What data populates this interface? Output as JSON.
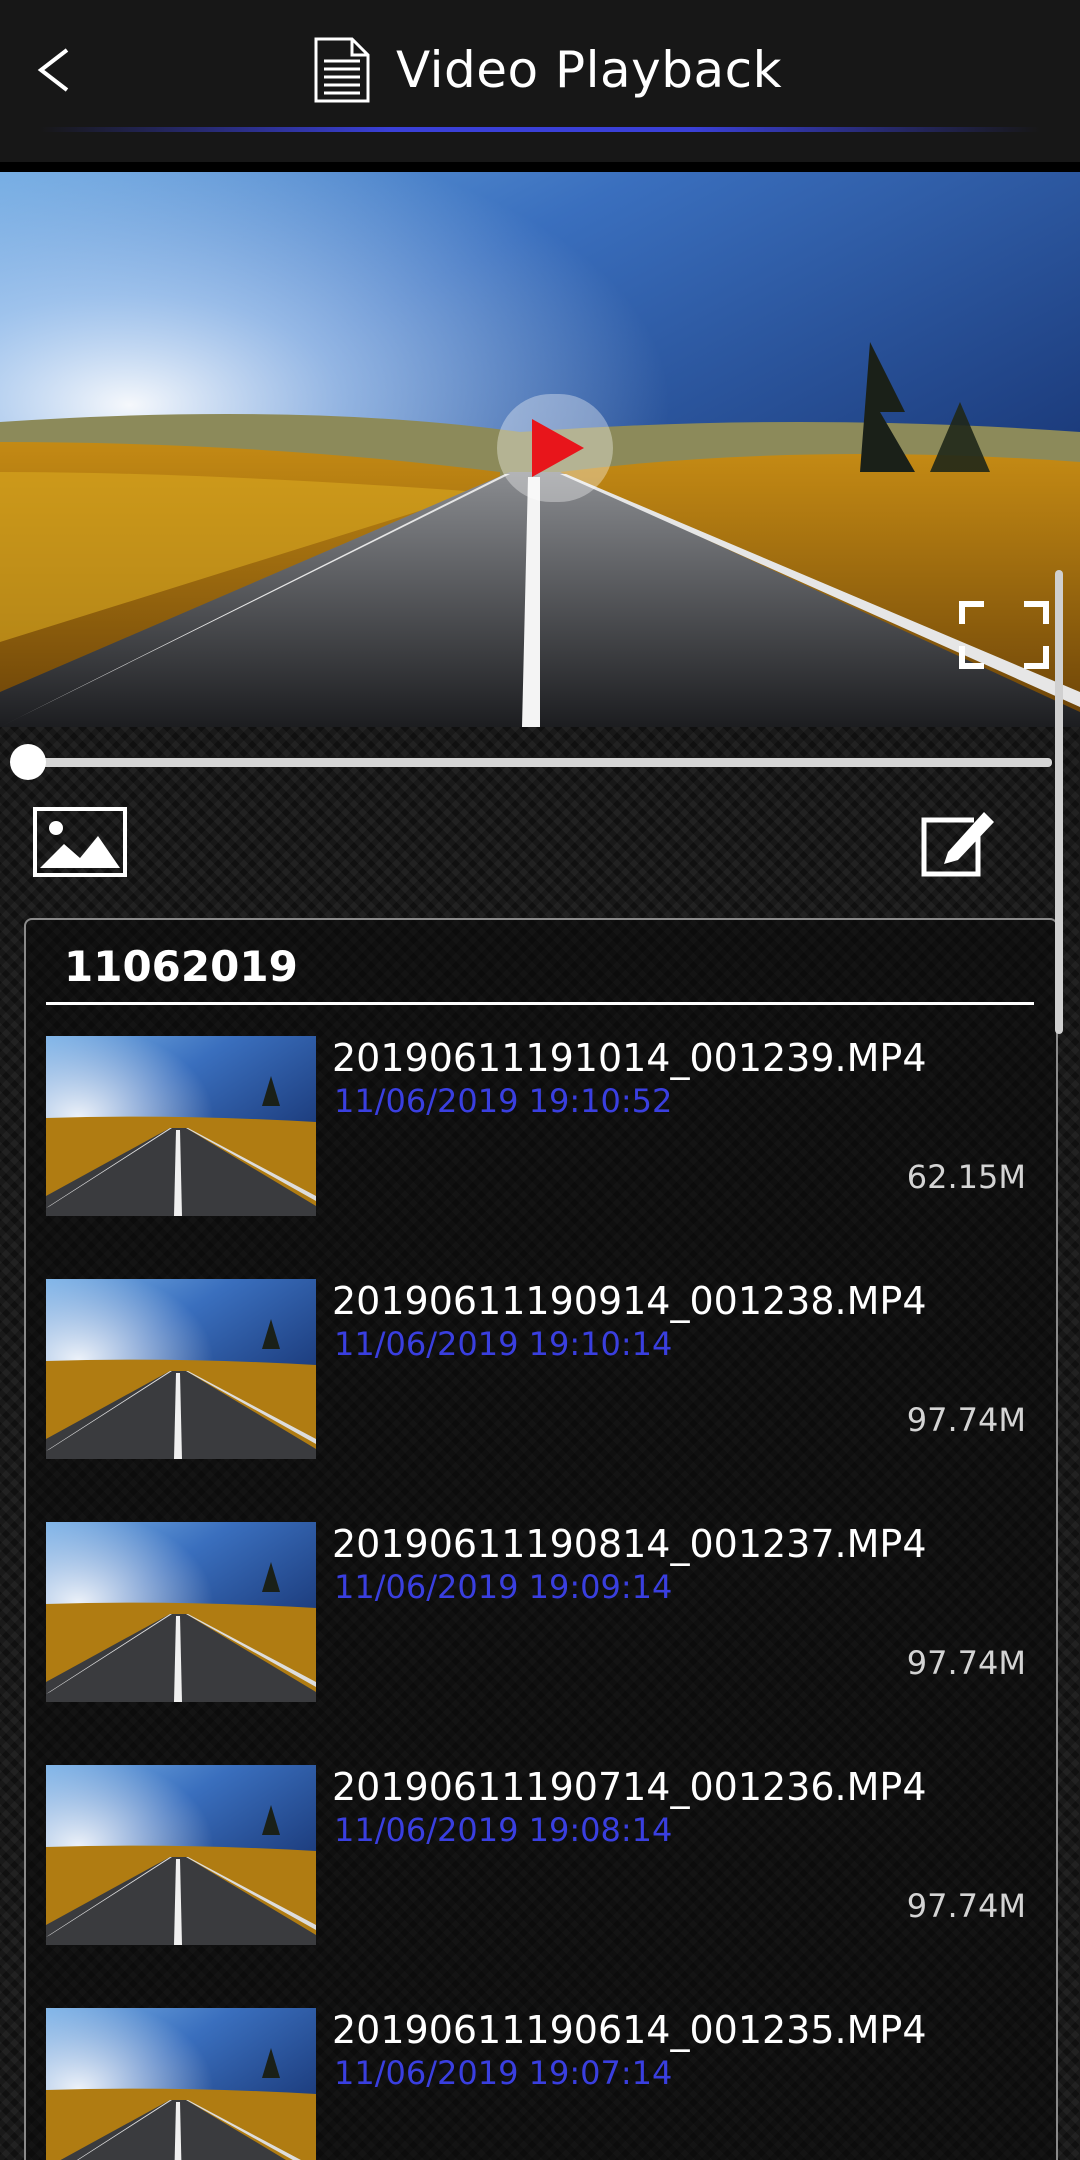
{
  "header": {
    "title": "Video Playback",
    "back_icon": "chevron-left-icon",
    "title_icon": "document-icon",
    "accent_color": "#3a40d8"
  },
  "player": {
    "progress": 0.0,
    "play_icon": "play-icon",
    "fullscreen_icon": "fullscreen-icon"
  },
  "toolbar": {
    "gallery_icon": "image-gallery-icon",
    "edit_icon": "edit-icon"
  },
  "list": {
    "date_group": "11062019",
    "items": [
      {
        "name": "20190611191014_001239.MP4",
        "date": "11/06/2019 19:10:52",
        "size": "62.15M"
      },
      {
        "name": "20190611190914_001238.MP4",
        "date": "11/06/2019 19:10:14",
        "size": "97.74M"
      },
      {
        "name": "20190611190814_001237.MP4",
        "date": "11/06/2019 19:09:14",
        "size": "97.74M"
      },
      {
        "name": "20190611190714_001236.MP4",
        "date": "11/06/2019 19:08:14",
        "size": "97.74M"
      },
      {
        "name": "20190611190614_001235.MP4",
        "date": "11/06/2019 19:07:14",
        "size": ""
      }
    ],
    "date_color": "#3a3fe0"
  }
}
